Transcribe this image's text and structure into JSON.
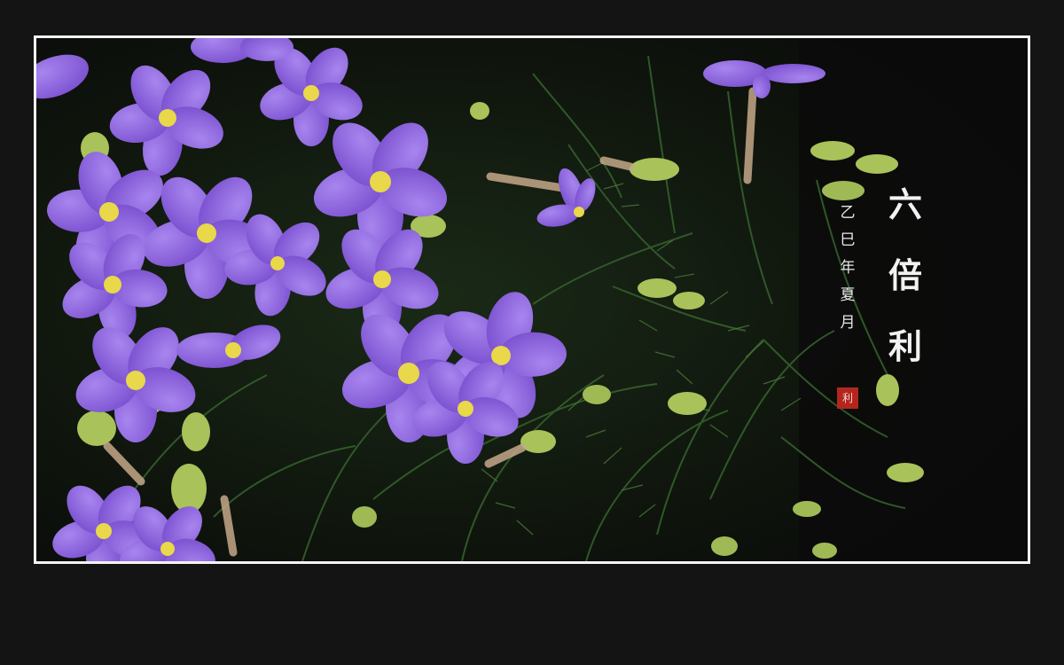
{
  "photo": {
    "subject": "purple-flowers-with-yellow-centers",
    "colors": {
      "background": "#141414",
      "frame_border": "#f4f4f4",
      "petal": "#8b5fd8",
      "petal_light": "#a07be8",
      "flower_center": "#e8d84a",
      "foliage": "#2f5a2a",
      "bud": "#a9c25a",
      "seal": "#b3261e"
    }
  },
  "calligraphy": {
    "title_chars": [
      "六",
      "倍",
      "利"
    ],
    "date_chars": [
      "乙",
      "巳",
      "年",
      "夏",
      "月"
    ],
    "seal_text": "利"
  }
}
